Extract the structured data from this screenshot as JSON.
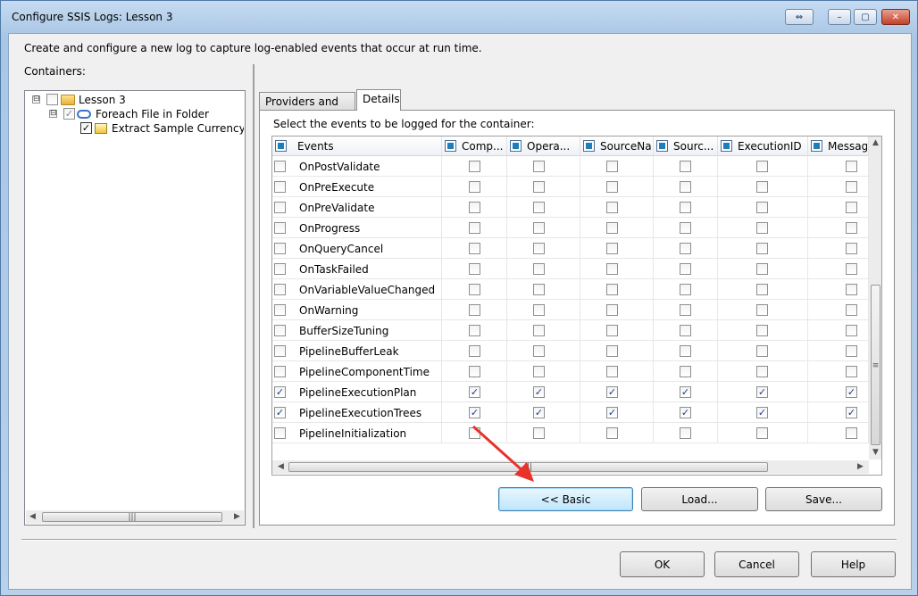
{
  "window": {
    "title": "Configure SSIS Logs: Lesson 3",
    "controls": [
      "⇔",
      "–",
      "▢",
      "✕"
    ]
  },
  "description": "Create and configure a new log to capture log-enabled events that occur at run time.",
  "containers": {
    "label": "Containers:",
    "tree": [
      {
        "label": "Lesson 3",
        "expander": "⊟",
        "checked": false,
        "icon": "folder-icon"
      },
      {
        "label": "Foreach File in Folder",
        "expander": "⊟",
        "checked": true,
        "icon": "foreach-loop-icon"
      },
      {
        "label": "Extract Sample Currency Data",
        "checked": true,
        "icon": "data-flow-task-icon"
      }
    ],
    "scroll_thumb": "|||"
  },
  "tabs": [
    {
      "label": "Providers and Logs",
      "active": false
    },
    {
      "label": "Details",
      "active": true
    }
  ],
  "details": {
    "instruction": "Select the events to be logged for the container:",
    "columns": [
      "Events",
      "Comp...",
      "Opera...",
      "SourceNa...",
      "Sourc...",
      "ExecutionID",
      "Message"
    ],
    "rows": [
      {
        "event": "OnPostValidate",
        "checked": false
      },
      {
        "event": "OnPreExecute",
        "checked": false
      },
      {
        "event": "OnPreValidate",
        "checked": false
      },
      {
        "event": "OnProgress",
        "checked": false
      },
      {
        "event": "OnQueryCancel",
        "checked": false
      },
      {
        "event": "OnTaskFailed",
        "checked": false
      },
      {
        "event": "OnVariableValueChanged",
        "checked": false
      },
      {
        "event": "OnWarning",
        "checked": false
      },
      {
        "event": "BufferSizeTuning",
        "checked": false
      },
      {
        "event": "PipelineBufferLeak",
        "checked": false
      },
      {
        "event": "PipelineComponentTime",
        "checked": false
      },
      {
        "event": "PipelineExecutionPlan",
        "checked": true
      },
      {
        "event": "PipelineExecutionTrees",
        "checked": true
      },
      {
        "event": "PipelineInitialization",
        "checked": false
      }
    ],
    "scroll_thumb": "|||",
    "buttons": {
      "basic": "<< Basic",
      "load": "Load...",
      "save": "Save..."
    }
  },
  "footer": {
    "ok": "OK",
    "cancel": "Cancel",
    "help": "Help"
  },
  "colors": {
    "accent": "#1e7fb8",
    "annotation_arrow": "#e8322a"
  }
}
